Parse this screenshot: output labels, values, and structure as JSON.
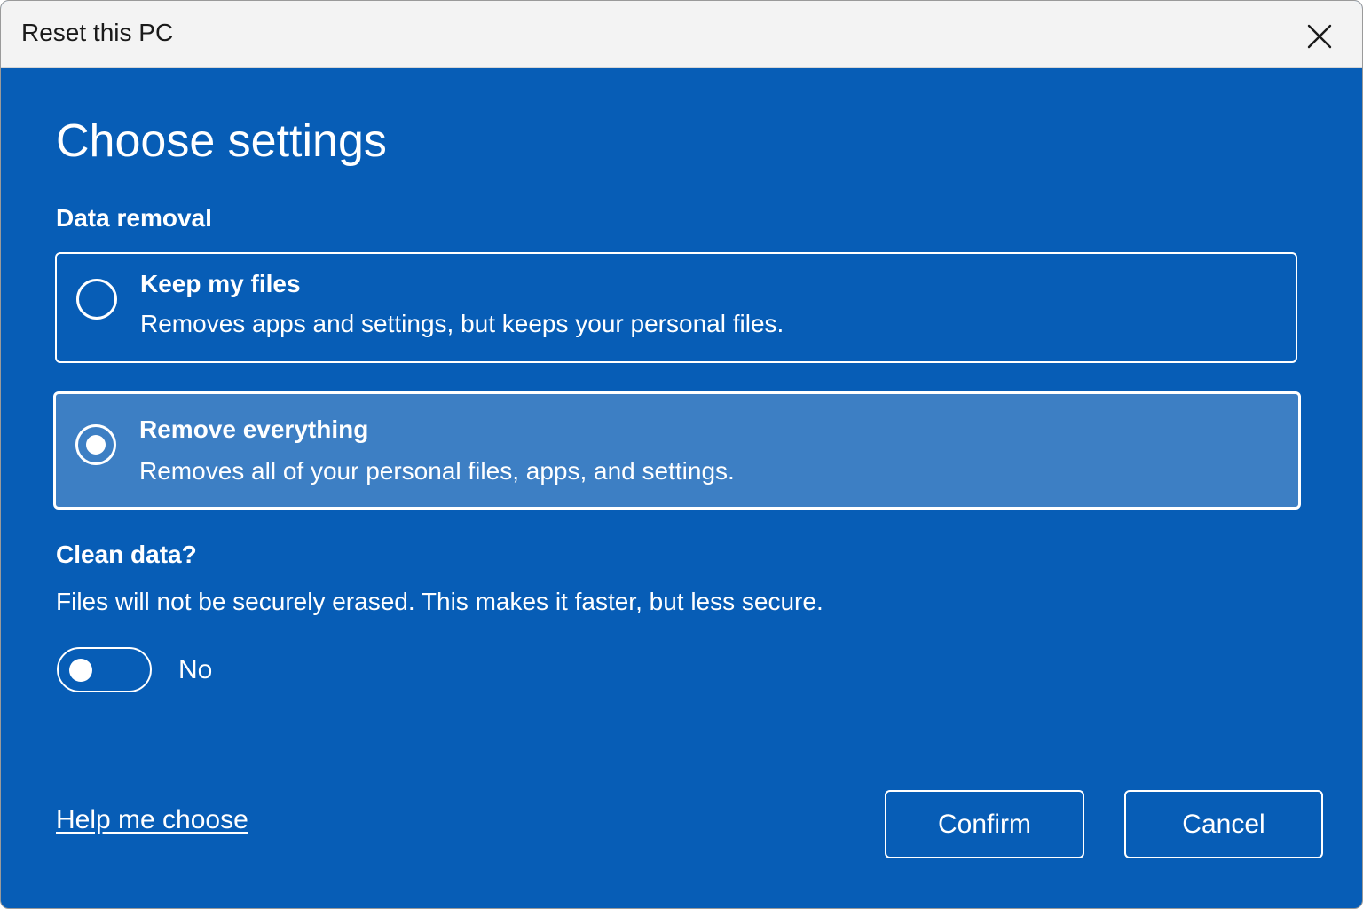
{
  "window": {
    "title": "Reset this PC",
    "close_icon": "close-icon"
  },
  "heading": "Choose settings",
  "data_removal": {
    "label": "Data removal",
    "options": [
      {
        "title": "Keep my files",
        "description": "Removes apps and settings, but keeps your personal files.",
        "selected": false
      },
      {
        "title": "Remove everything",
        "description": "Removes all of your personal files, apps, and settings.",
        "selected": true
      }
    ]
  },
  "clean_data": {
    "label": "Clean data?",
    "description": "Files will not be securely erased. This makes it faster, but less secure.",
    "toggle_on": false,
    "toggle_label": "No"
  },
  "footer": {
    "help_link": "Help me choose",
    "confirm_label": "Confirm",
    "cancel_label": "Cancel"
  },
  "colors": {
    "background": "#075db6",
    "selected_option": "#3d7fc4",
    "titlebar": "#f3f3f3",
    "foreground": "#ffffff"
  }
}
